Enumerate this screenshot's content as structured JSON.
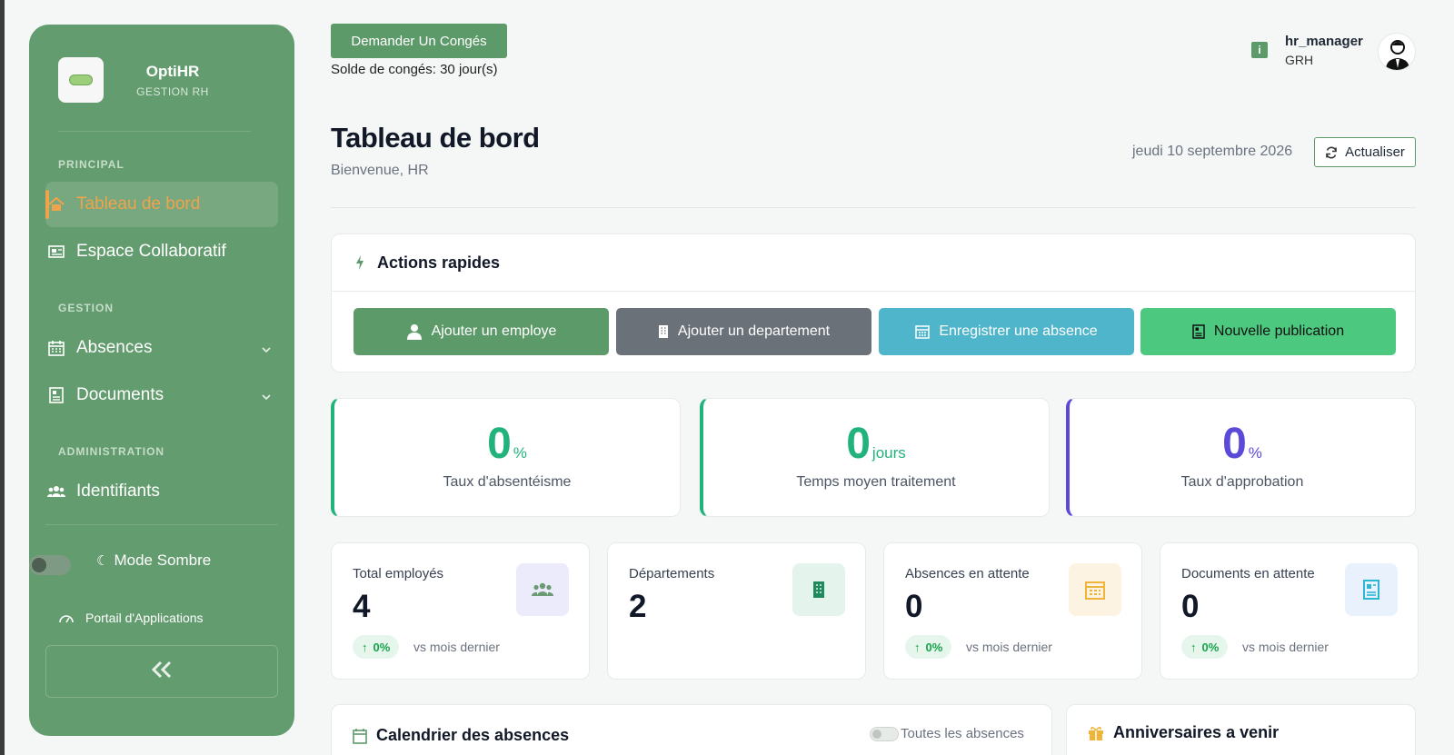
{
  "sidebar": {
    "brand": {
      "name": "OptiHR",
      "subtitle": "GESTION RH"
    },
    "sections": [
      {
        "title": "PRINCIPAL",
        "items": [
          {
            "label": "Tableau de bord",
            "icon": "home-icon",
            "active": true
          },
          {
            "label": "Espace Collaboratif",
            "icon": "newspaper-icon"
          }
        ]
      },
      {
        "title": "GESTION",
        "items": [
          {
            "label": "Absences",
            "icon": "calendar-icon",
            "expandable": true
          },
          {
            "label": "Documents",
            "icon": "document-icon",
            "expandable": true
          }
        ]
      },
      {
        "title": "ADMINISTRATION",
        "items": [
          {
            "label": "Identifiants",
            "icon": "users-icon"
          }
        ]
      }
    ],
    "dark_mode_label": "Mode Sombre",
    "portal_label": "Portail d'Applications"
  },
  "topbar": {
    "leave_button": "Demander Un Congés",
    "leave_balance": "Solde de congés: 30 jour(s)",
    "user": {
      "name": "hr_manager",
      "role": "GRH"
    }
  },
  "header": {
    "title": "Tableau de bord",
    "subtitle": "Bienvenue, HR",
    "date": "jeudi 10 septembre 2026",
    "refresh_label": "Actualiser"
  },
  "quick_actions": {
    "title": "Actions rapides",
    "buttons": [
      {
        "label": "Ajouter un employe",
        "icon": "user-icon",
        "color": "#5d9a6a"
      },
      {
        "label": "Ajouter un departement",
        "icon": "building-icon",
        "color": "#6b7178"
      },
      {
        "label": "Enregistrer une absence",
        "icon": "calendar-icon",
        "color": "#4fb5cb"
      },
      {
        "label": "Nouvelle publication",
        "icon": "newspaper-icon",
        "color": "#4cc97f"
      }
    ]
  },
  "kpis": [
    {
      "value": "0",
      "unit": "%",
      "label": "Taux d'absentéisme",
      "color": "#22b27c"
    },
    {
      "value": "0",
      "unit": "jours",
      "label": "Temps moyen traitement",
      "color": "#22b27c"
    },
    {
      "value": "0",
      "unit": "%",
      "label": "Taux d'approbation",
      "color": "#5b4ad8"
    }
  ],
  "stats": [
    {
      "label": "Total employés",
      "value": "4",
      "badge": "0%",
      "compare": "vs mois dernier",
      "icon": "users-icon",
      "icon_bg": "#ecebfb",
      "icon_color": "#6b9b72"
    },
    {
      "label": "Départements",
      "value": "2",
      "icon": "building-icon",
      "icon_bg": "#e4f4ec",
      "icon_color": "#1f8a5b"
    },
    {
      "label": "Absences en attente",
      "value": "0",
      "badge": "0%",
      "compare": "vs mois dernier",
      "icon": "calendar-icon",
      "icon_bg": "#fdf3e3",
      "icon_color": "#f0b43a"
    },
    {
      "label": "Documents en attente",
      "value": "0",
      "badge": "0%",
      "compare": "vs mois dernier",
      "icon": "document-icon",
      "icon_bg": "#e8f1fc",
      "icon_color": "#2bb7d4"
    }
  ],
  "calendar": {
    "title": "Calendrier des absences",
    "toggle_label": "Toutes les absences"
  },
  "birthdays": {
    "title": "Anniversaires a venir"
  }
}
